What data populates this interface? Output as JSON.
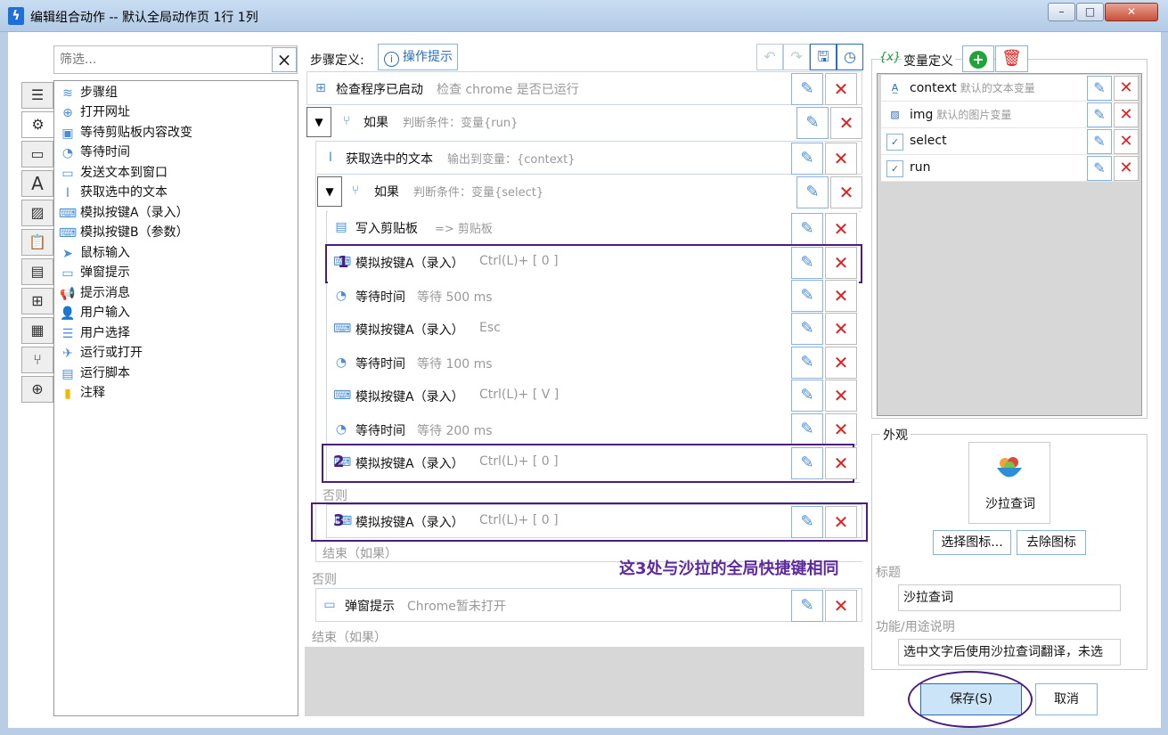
{
  "window": {
    "title": "编辑组合动作 -- 默认全局动作页 1行 1列",
    "app_icon": "lightning-icon"
  },
  "filter": {
    "placeholder": "筛选...",
    "clear": "×"
  },
  "toolbox": [
    {
      "label": "步骤组",
      "icon": "layers-icon"
    },
    {
      "label": "打开网址",
      "icon": "globe-icon"
    },
    {
      "label": "等待剪贴板内容改变",
      "icon": "clipboard-wait-icon"
    },
    {
      "label": "等待时间",
      "icon": "stopwatch-icon"
    },
    {
      "label": "发送文本到窗口",
      "icon": "message-icon"
    },
    {
      "label": "获取选中的文本",
      "icon": "text-cursor-icon"
    },
    {
      "label": "模拟按键A（录入）",
      "icon": "keyboard-icon"
    },
    {
      "label": "模拟按键B（参数）",
      "icon": "keyboard-icon"
    },
    {
      "label": "鼠标输入",
      "icon": "cursor-icon"
    },
    {
      "label": "弹窗提示",
      "icon": "window-icon"
    },
    {
      "label": "提示消息",
      "icon": "megaphone-icon"
    },
    {
      "label": "用户输入",
      "icon": "user-edit-icon"
    },
    {
      "label": "用户选择",
      "icon": "list-icon"
    },
    {
      "label": "运行或打开",
      "icon": "send-icon"
    },
    {
      "label": "运行脚本",
      "icon": "script-icon"
    },
    {
      "label": "注释",
      "icon": "note-icon"
    }
  ],
  "sidetabs": [
    "menu-icon",
    "gear-icon",
    "window-icon",
    "font-icon",
    "image-icon",
    "clipboard-icon",
    "document-icon",
    "windows-icon",
    "calculator-icon",
    "git-branch-icon",
    "globe-icon"
  ],
  "steps_header": {
    "label": "步骤定义:",
    "hint": "操作提示"
  },
  "steps": [
    {
      "name": "检查程序已启动",
      "desc": "检查 chrome 是否已运行"
    },
    {
      "name": "如果",
      "desc": "判断条件：变量{run}"
    },
    {
      "name": "获取选中的文本",
      "desc": "输出到变量：{context}"
    },
    {
      "name": "如果",
      "desc": "判断条件：变量{select}"
    },
    {
      "name": "写入剪贴板",
      "desc": "=> 剪贴板"
    },
    {
      "name": "模拟按键A（录入）",
      "desc": "Ctrl(L)+ [ 0 ]",
      "mark": "1"
    },
    {
      "name": "等待时间",
      "desc": "等待 500 ms"
    },
    {
      "name": "模拟按键A（录入）",
      "desc": "Esc"
    },
    {
      "name": "等待时间",
      "desc": "等待 100 ms"
    },
    {
      "name": "模拟按键A（录入）",
      "desc": "Ctrl(L)+ [ V ]"
    },
    {
      "name": "等待时间",
      "desc": "等待 200 ms"
    },
    {
      "name": "模拟按键A（录入）",
      "desc": "Ctrl(L)+ [ 0 ]",
      "mark": "2"
    },
    {
      "name": "模拟按键A（录入）",
      "desc": "Ctrl(L)+ [ 0 ]",
      "mark": "3"
    },
    {
      "name": "弹窗提示",
      "desc": "Chrome暂未打开"
    }
  ],
  "labels": {
    "else": "否则",
    "end_if": "结束（如果）"
  },
  "annotation": "这3处与沙拉的全局快捷键相同",
  "variables": {
    "label": "变量定义",
    "items": [
      {
        "name": "context",
        "desc": "默认的文本变量",
        "icon": "text-var-icon"
      },
      {
        "name": "img",
        "desc": "默认的图片变量",
        "icon": "image-var-icon"
      },
      {
        "name": "select",
        "desc": "",
        "icon": "checkbox-checked-icon"
      },
      {
        "name": "run",
        "desc": "",
        "icon": "checkbox-checked-icon"
      }
    ]
  },
  "appearance": {
    "label": "外观",
    "preview_name": "沙拉查词",
    "choose_icon": "选择图标...",
    "remove_icon": "去除图标",
    "title_label": "标题",
    "title_value": "沙拉查词",
    "desc_label": "功能/用途说明",
    "desc_value": "选中文字后使用沙拉查词翻译，未选"
  },
  "footer": {
    "save": "保存(S)",
    "cancel": "取消"
  }
}
